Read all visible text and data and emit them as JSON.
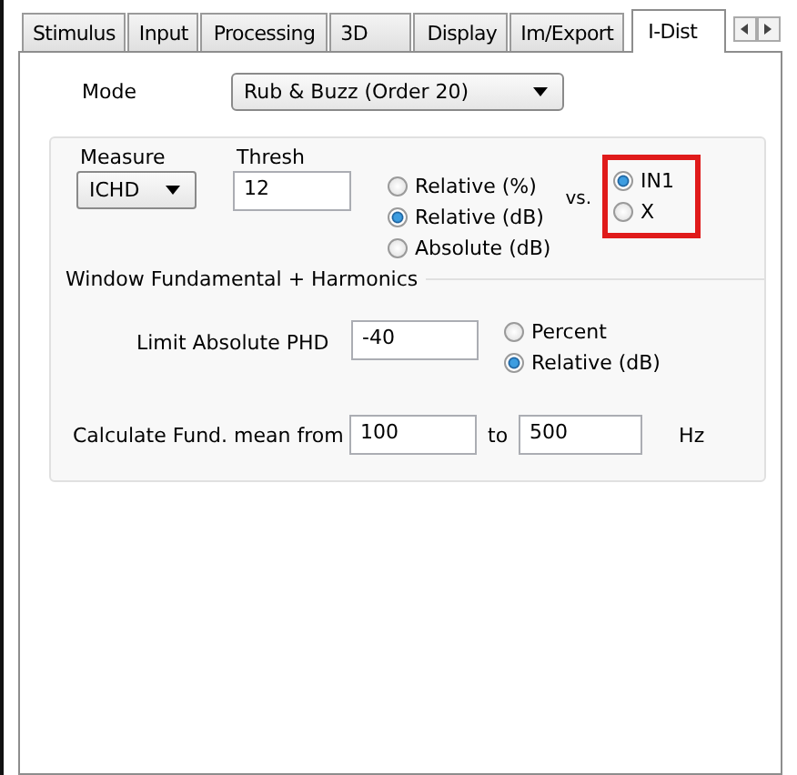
{
  "tabs": [
    {
      "label": "Stimulus",
      "selected": false
    },
    {
      "label": "Input",
      "selected": false
    },
    {
      "label": "Processing",
      "selected": false
    },
    {
      "label": "3D",
      "selected": false
    },
    {
      "label": "Display",
      "selected": false
    },
    {
      "label": "Im/Export",
      "selected": false
    },
    {
      "label": "I-Dist",
      "selected": true
    }
  ],
  "mode": {
    "label": "Mode",
    "value": "Rub & Buzz (Order 20)"
  },
  "measure": {
    "label": "Measure",
    "value": "ICHD"
  },
  "thresh": {
    "label": "Thresh",
    "value": "12"
  },
  "scale_options": [
    {
      "label": "Relative (%)",
      "selected": false
    },
    {
      "label": "Relative (dB)",
      "selected": true
    },
    {
      "label": "Absolute (dB)",
      "selected": false
    }
  ],
  "vs_label": "vs.",
  "reference_options": [
    {
      "label": "IN1",
      "selected": true
    },
    {
      "label": "X",
      "selected": false
    }
  ],
  "window_group": {
    "title": "Window Fundamental + Harmonics",
    "limit": {
      "label": "Limit Absolute PHD",
      "value": "-40"
    },
    "limit_options": [
      {
        "label": "Percent",
        "selected": false
      },
      {
        "label": "Relative (dB)",
        "selected": true
      }
    ],
    "fund_mean": {
      "label": "Calculate Fund. mean from",
      "from": "100",
      "to_label": "to",
      "to": "500",
      "unit": "Hz"
    }
  }
}
